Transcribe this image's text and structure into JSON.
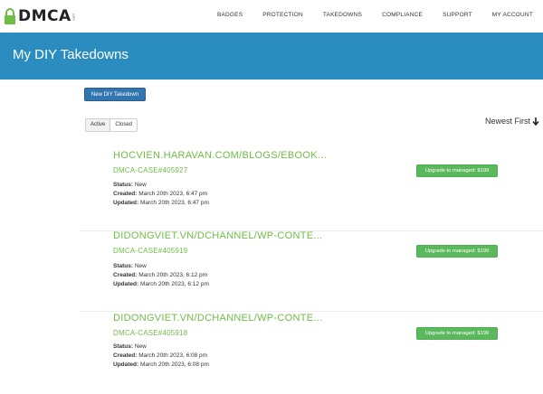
{
  "brand": {
    "logo_text": "DMCA",
    "logo_sub": ".com"
  },
  "nav": {
    "items": [
      "BADGES",
      "PROTECTION",
      "TAKEDOWNS",
      "COMPLIANCE",
      "SUPPORT",
      "MY ACCOUNT"
    ]
  },
  "header": {
    "title": "My DIY Takedowns"
  },
  "toolbar": {
    "new_label": "New DIY Takedown",
    "filters": [
      "Active",
      "Closed"
    ],
    "sort_label": "Newest First"
  },
  "colors": {
    "header_bg": "#2b8dbf",
    "link_green": "#6ebd45",
    "upgrade_green": "#5cb85c",
    "primary_blue": "#3276b1"
  },
  "cases": [
    {
      "url": "HOCVIEN.HARAVAN.COM/BLOGS/EBOOK...",
      "case_id": "DMCA-CASE#405927",
      "status_label": "Status:",
      "status": "New",
      "created_label": "Created:",
      "created": "March 20th 2023, 6:47 pm",
      "updated_label": "Updated:",
      "updated": "March 20th 2023, 6:47 pm",
      "upgrade_label": "Upgrade to managed: $199"
    },
    {
      "url": "DIDONGVIET.VN/DCHANNEL/WP-CONTE...",
      "case_id": "DMCA-CASE#405919",
      "status_label": "Status:",
      "status": "New",
      "created_label": "Created:",
      "created": "March 20th 2023, 6:12 pm",
      "updated_label": "Updated:",
      "updated": "March 20th 2023, 6:12 pm",
      "upgrade_label": "Upgrade to managed: $199"
    },
    {
      "url": "DIDONGVIET.VN/DCHANNEL/WP-CONTE...",
      "case_id": "DMCA-CASE#405918",
      "status_label": "Status:",
      "status": "New",
      "created_label": "Created:",
      "created": "March 20th 2023, 6:08 pm",
      "updated_label": "Updated:",
      "updated": "March 20th 2023, 6:08 pm",
      "upgrade_label": "Upgrade to managed: $199"
    }
  ]
}
